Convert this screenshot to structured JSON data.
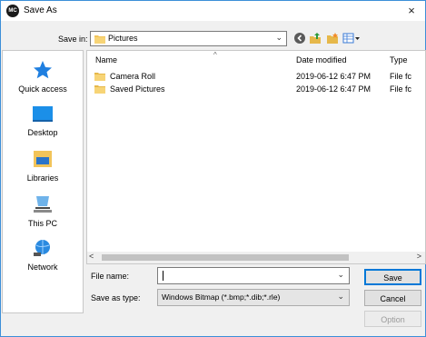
{
  "window": {
    "title": "Save As",
    "app_icon_text": "MC",
    "close": "×"
  },
  "savein": {
    "label": "Save in:",
    "value": "Pictures"
  },
  "toolbar": {
    "icons": [
      "back-icon",
      "up-folder-icon",
      "new-folder-icon",
      "view-menu-icon"
    ]
  },
  "places": [
    {
      "label": "Quick access",
      "icon": "quick-access-icon"
    },
    {
      "label": "Desktop",
      "icon": "desktop-icon"
    },
    {
      "label": "Libraries",
      "icon": "libraries-icon"
    },
    {
      "label": "This PC",
      "icon": "this-pc-icon"
    },
    {
      "label": "Network",
      "icon": "network-icon"
    }
  ],
  "filelist": {
    "columns": [
      "Name",
      "Date modified",
      "Type"
    ],
    "rows": [
      {
        "name": "Camera Roll",
        "date": "2019-06-12 6:47 PM",
        "type": "File fc"
      },
      {
        "name": "Saved Pictures",
        "date": "2019-06-12 6:47 PM",
        "type": "File fc"
      }
    ]
  },
  "form": {
    "filename_label": "File name:",
    "filename_value": "",
    "type_label": "Save as type:",
    "type_value": "Windows Bitmap (*.bmp;*.dib;*.rle)"
  },
  "buttons": {
    "save": "Save",
    "cancel": "Cancel",
    "option": "Option"
  },
  "colors": {
    "accent": "#0078d7",
    "folder": "#f2c45a"
  }
}
